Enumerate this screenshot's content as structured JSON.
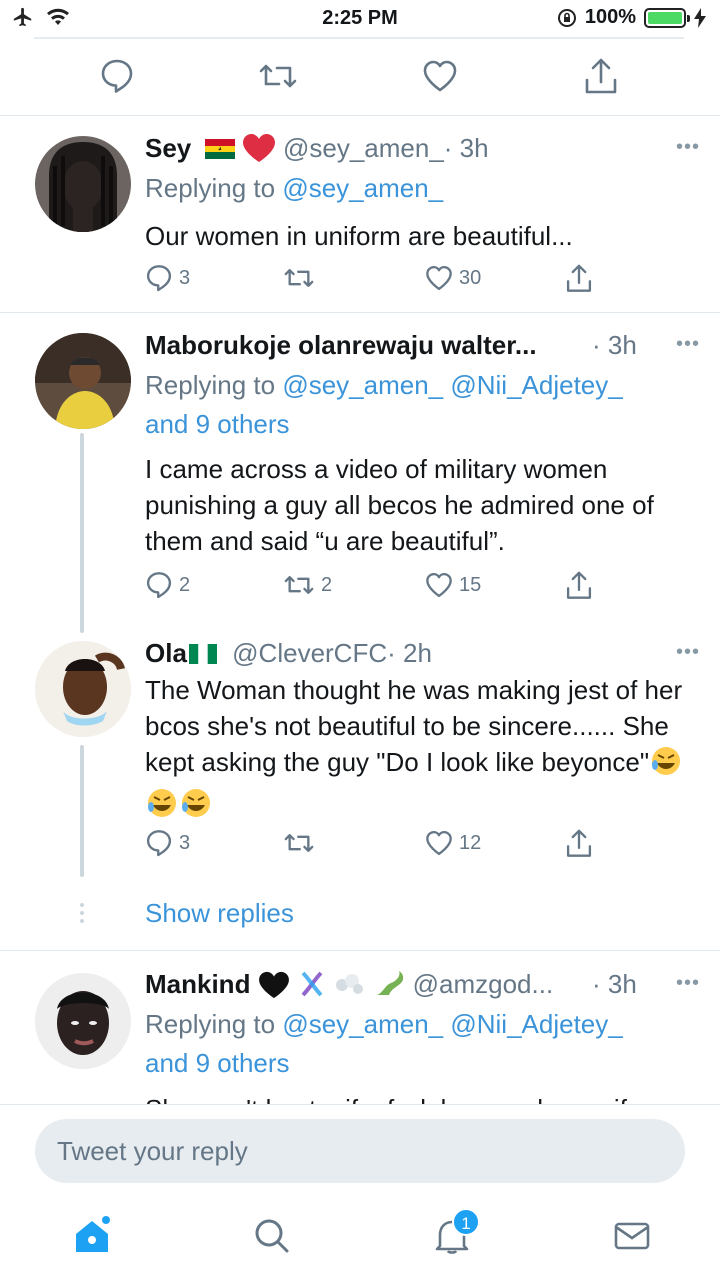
{
  "status_bar": {
    "time": "2:25 PM",
    "battery": "100%"
  },
  "tweets": [
    {
      "name": "Sey",
      "handle": "@sey_amen_",
      "time": "· 3h",
      "replying_label": "Replying to",
      "replying_to": "@sey_amen_",
      "text": "Our women in uniform are beautiful...",
      "replies": "3",
      "retweets": "",
      "likes": "30"
    },
    {
      "name": "Maborukoje olanrewaju walter...",
      "handle": "",
      "time": "· 3h",
      "replying_label": "Replying to",
      "replying_to": "@sey_amen_ @Nii_Adjetey_",
      "replying_others": "and 9 others",
      "text": "I came across a video of military women punishing a guy all becos he admired one of them and said “u are beautiful”.",
      "replies": "2",
      "retweets": "2",
      "likes": "15"
    },
    {
      "name": "Ola",
      "handle": "@CleverCFC",
      "time": "· 2h",
      "text": "The Woman thought he was making jest of her bcos she's not beautiful to be sincere...... She kept asking the guy \"Do I look like beyonce\"",
      "replies": "3",
      "retweets": "",
      "likes": "12"
    },
    {
      "name": "Mankind",
      "handle": "@amzgod...",
      "time": "· 3h",
      "replying_label": "Replying to",
      "replying_to": "@sey_amen_ @Nii_Adjetey_",
      "replying_others": "and 9 others",
      "text": "She won't beat u if u fvck her good even if"
    }
  ],
  "show_replies": "Show replies",
  "composer": {
    "placeholder": "Tweet your reply"
  },
  "tabbar": {
    "notification_count": "1"
  },
  "colors": {
    "accent": "#1da1f2",
    "link": "#3b94d9",
    "muted": "#657786"
  }
}
